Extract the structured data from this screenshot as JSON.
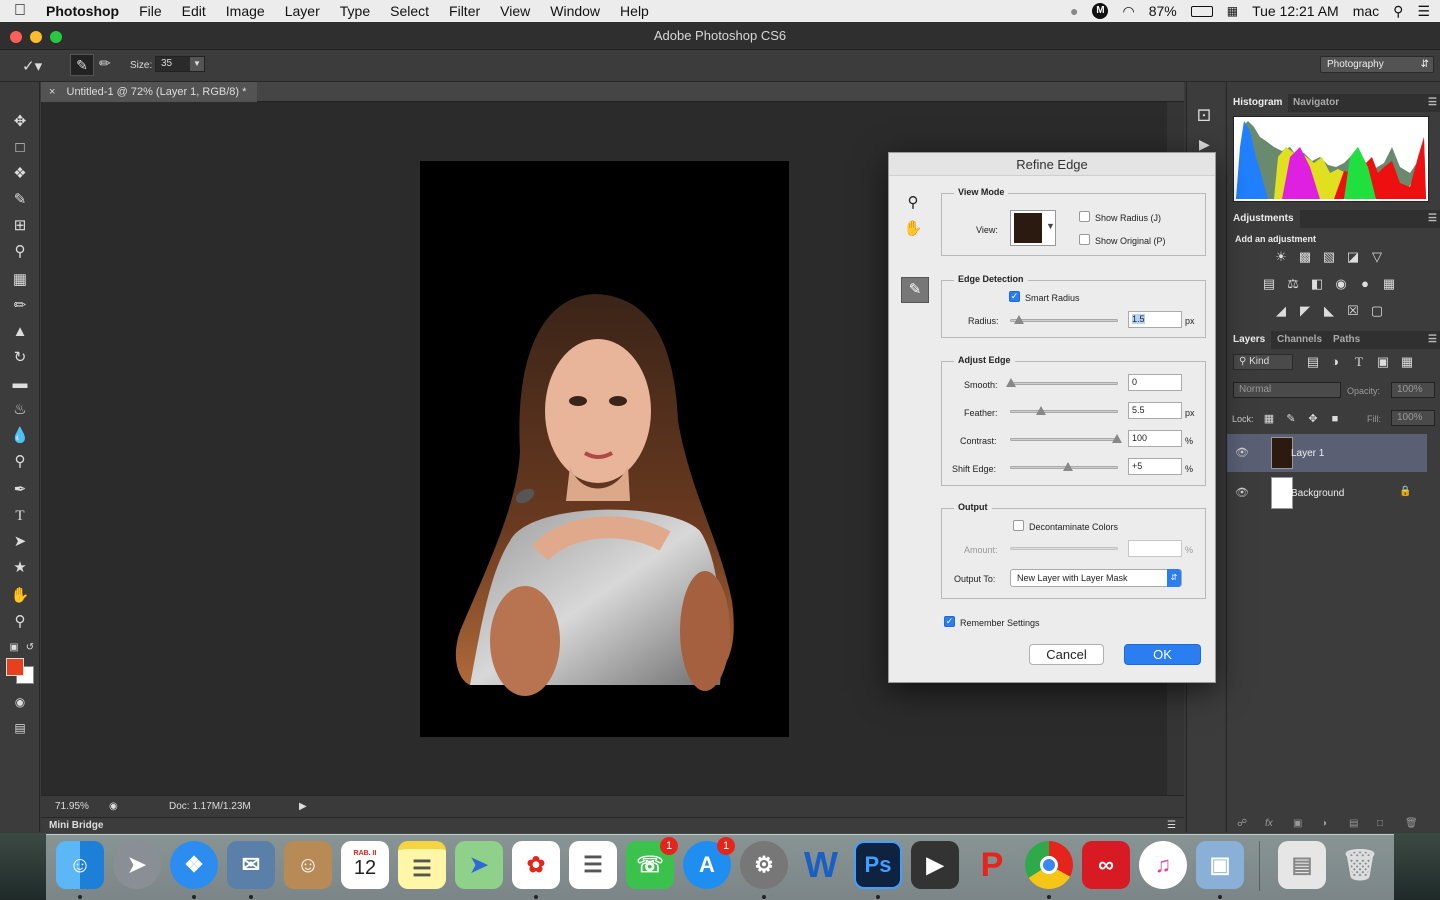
{
  "menubar": {
    "app_name": "Photoshop",
    "items": [
      "File",
      "Edit",
      "Image",
      "Layer",
      "Type",
      "Select",
      "Filter",
      "View",
      "Window",
      "Help"
    ],
    "battery": "87%",
    "clock": "Tue 12:21 AM",
    "user": "mac"
  },
  "window": {
    "title": "Adobe Photoshop CS6"
  },
  "options_bar": {
    "size_label": "Size:",
    "size_value": "35",
    "workspace": "Photography"
  },
  "document": {
    "tab_title": "Untitled-1 @ 72% (Layer 1, RGB/8) *",
    "zoom": "71.95%",
    "doc_info": "Doc: 1.17M/1.23M"
  },
  "mini_bridge": {
    "label": "Mini Bridge"
  },
  "panels": {
    "histogram_tabs": [
      "Histogram",
      "Navigator"
    ],
    "adjustments": {
      "tab": "Adjustments",
      "subtitle": "Add an adjustment"
    },
    "layers_tabs": [
      "Layers",
      "Channels",
      "Paths"
    ],
    "kind_filter": "Kind",
    "blend_mode": "Normal",
    "opacity_label": "Opacity:",
    "opacity_value": "100%",
    "lock_label": "Lock:",
    "fill_label": "Fill:",
    "fill_value": "100%",
    "layers": [
      {
        "name": "Layer 1",
        "selected": true
      },
      {
        "name": "Background",
        "locked": true
      }
    ]
  },
  "dialog": {
    "title": "Refine Edge",
    "view_mode": {
      "title": "View Mode",
      "view_label": "View:",
      "show_radius": "Show Radius (J)",
      "show_original": "Show Original (P)"
    },
    "edge_detection": {
      "title": "Edge Detection",
      "smart_radius": "Smart Radius",
      "radius_label": "Radius:",
      "radius_value": "1.5",
      "radius_unit": "px"
    },
    "adjust_edge": {
      "title": "Adjust Edge",
      "smooth_label": "Smooth:",
      "smooth_value": "0",
      "feather_label": "Feather:",
      "feather_value": "5.5",
      "feather_unit": "px",
      "contrast_label": "Contrast:",
      "contrast_value": "100",
      "contrast_unit": "%",
      "shift_label": "Shift Edge:",
      "shift_value": "+5",
      "shift_unit": "%"
    },
    "output": {
      "title": "Output",
      "decontaminate": "Decontaminate Colors",
      "amount_label": "Amount:",
      "amount_unit": "%",
      "output_to_label": "Output To:",
      "output_to_value": "New Layer with Layer Mask"
    },
    "remember": "Remember Settings",
    "cancel": "Cancel",
    "ok": "OK"
  },
  "dock": {
    "calendar_month": "RAB. II",
    "calendar_day": "12",
    "facetime_badge": "1",
    "appstore_badge": "1",
    "word_letter": "W",
    "ps_letters": "Ps"
  },
  "colors": {
    "foreground": "#e8401c",
    "background": "#ffffff",
    "accent": "#2a7ef1"
  }
}
